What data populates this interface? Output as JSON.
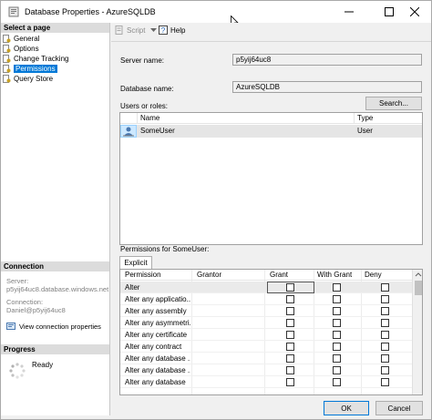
{
  "window": {
    "title": "Database Properties - AzureSQLDB",
    "minimize_icon": "minimize-icon",
    "maximize_icon": "maximize-icon",
    "close_icon": "close-icon"
  },
  "left_pane": {
    "select_page_header": "Select a page",
    "pages": [
      {
        "label": "General",
        "icon": "page-wrench-icon",
        "selected": false
      },
      {
        "label": "Options",
        "icon": "page-wrench-icon",
        "selected": false
      },
      {
        "label": "Change Tracking",
        "icon": "page-wrench-icon",
        "selected": false
      },
      {
        "label": "Permissions",
        "icon": "page-wrench-icon",
        "selected": true
      },
      {
        "label": "Query Store",
        "icon": "page-wrench-icon",
        "selected": false
      }
    ],
    "connection_header": "Connection",
    "server_label": "Server:",
    "server_value": "p5yij64uc8.database.windows.net",
    "connection_label": "Connection:",
    "connection_value": "Daniel@p5yij64uc8",
    "view_connection_properties": "View connection properties",
    "progress_header": "Progress",
    "progress_status": "Ready"
  },
  "toolbar": {
    "script_label": "Script",
    "help_label": "Help"
  },
  "form": {
    "server_name_label": "Server name:",
    "server_name_value": "p5yij64uc8",
    "database_name_label": "Database name:",
    "database_name_value": "AzureSQLDB",
    "users_or_roles_label": "Users or roles:",
    "search_button": "Search..."
  },
  "users_grid": {
    "columns": [
      "Name",
      "Type"
    ],
    "rows": [
      {
        "name": "SomeUser",
        "type": "User",
        "icon": "user-icon"
      }
    ]
  },
  "permissions": {
    "label": "Permissions for SomeUser:",
    "tab_label": "Explicit",
    "columns": [
      "Permission",
      "Grantor",
      "Grant",
      "With Grant",
      "Deny"
    ],
    "rows": [
      {
        "permission": "Alter",
        "grantor": "",
        "grant": false,
        "with_grant": false,
        "deny": false
      },
      {
        "permission": "Alter any applicatio...",
        "grantor": "",
        "grant": false,
        "with_grant": false,
        "deny": false
      },
      {
        "permission": "Alter any assembly",
        "grantor": "",
        "grant": false,
        "with_grant": false,
        "deny": false
      },
      {
        "permission": "Alter any asymmetri...",
        "grantor": "",
        "grant": false,
        "with_grant": false,
        "deny": false
      },
      {
        "permission": "Alter any certificate",
        "grantor": "",
        "grant": false,
        "with_grant": false,
        "deny": false
      },
      {
        "permission": "Alter any contract",
        "grantor": "",
        "grant": false,
        "with_grant": false,
        "deny": false
      },
      {
        "permission": "Alter any database ...",
        "grantor": "",
        "grant": false,
        "with_grant": false,
        "deny": false
      },
      {
        "permission": "Alter any database ...",
        "grantor": "",
        "grant": false,
        "with_grant": false,
        "deny": false
      },
      {
        "permission": "Alter any database",
        "grantor": "",
        "grant": false,
        "with_grant": false,
        "deny": false
      }
    ]
  },
  "footer": {
    "ok_button": "OK",
    "cancel_button": "Cancel"
  },
  "colors": {
    "selection_blue": "#0078d7",
    "dialog_background": "#f0f0f0",
    "section_header_gray": "#dcdcdc"
  }
}
